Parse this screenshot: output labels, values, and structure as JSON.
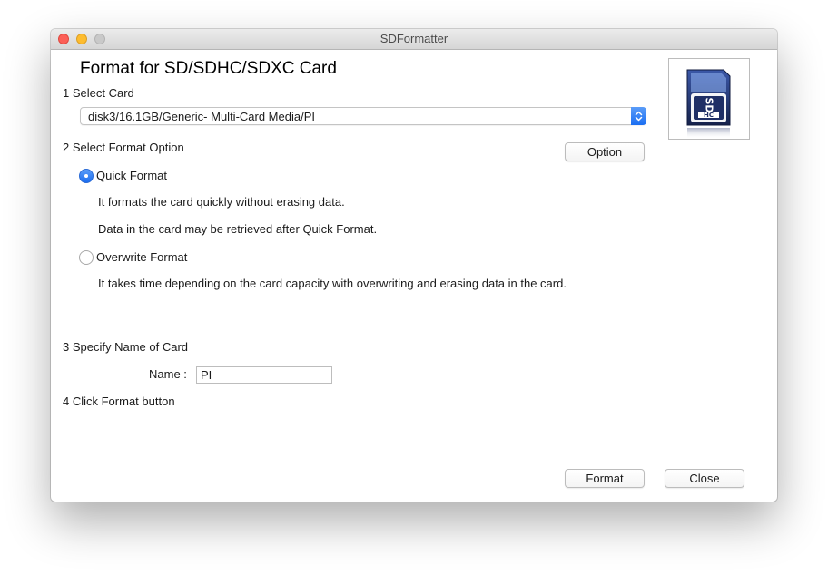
{
  "window": {
    "title": "SDFormatter"
  },
  "heading": "Format for SD/SDHC/SDXC Card",
  "step1": {
    "label": "1 Select Card",
    "selected_card": "disk3/16.1GB/Generic- Multi-Card Media/PI"
  },
  "step2": {
    "label": "2 Select Format Option",
    "option_button": "Option",
    "quick": {
      "label": "Quick Format",
      "selected": true,
      "desc1": "It formats the card quickly without erasing data.",
      "desc2": "Data in the card may be retrieved after Quick Format."
    },
    "overwrite": {
      "label": "Overwrite Format",
      "selected": false,
      "desc": "It takes time depending on the card capacity with overwriting and erasing data in the card."
    }
  },
  "step3": {
    "label": "3 Specify Name of Card",
    "name_label": "Name :",
    "name_value": "PI"
  },
  "step4": {
    "label": "4 Click Format button"
  },
  "buttons": {
    "format": "Format",
    "close": "Close"
  },
  "card_image": {
    "logo_text": "SDHC",
    "icon": "sdhc-card-icon"
  },
  "colors": {
    "accent": "#1c6ef0",
    "card_body": "#1f2f66"
  }
}
